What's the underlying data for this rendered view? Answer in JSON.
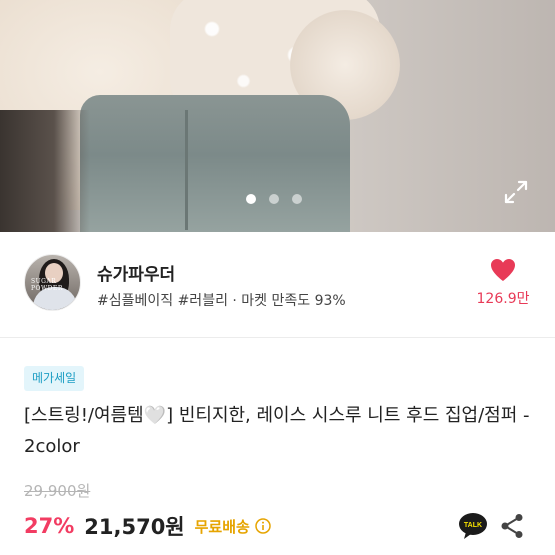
{
  "gallery": {
    "image_count": 3,
    "active_index": 0
  },
  "seller": {
    "name": "슈가파우더",
    "tags": "#심플베이직 #러블리 · 마켓 만족도 93%",
    "avatar_text": "SUGAR POWDER",
    "likes": "126.9만"
  },
  "product": {
    "badge": "메가세일",
    "title": "[스트링!/여름템🤍] 빈티지한, 레이스 시스루 니트 후드 집업/점퍼 - 2color",
    "original_price": "29,900원",
    "discount": "27%",
    "price": "21,570원",
    "shipping": "무료배송"
  },
  "colors": {
    "accent_pink": "#f23c62",
    "like_red": "#e83a57",
    "shipping_gold": "#e6a400",
    "badge_blue": "#1d9ec4"
  },
  "icons": [
    "expand-icon",
    "heart-icon",
    "info-icon",
    "kakao-talk-icon",
    "share-icon"
  ]
}
